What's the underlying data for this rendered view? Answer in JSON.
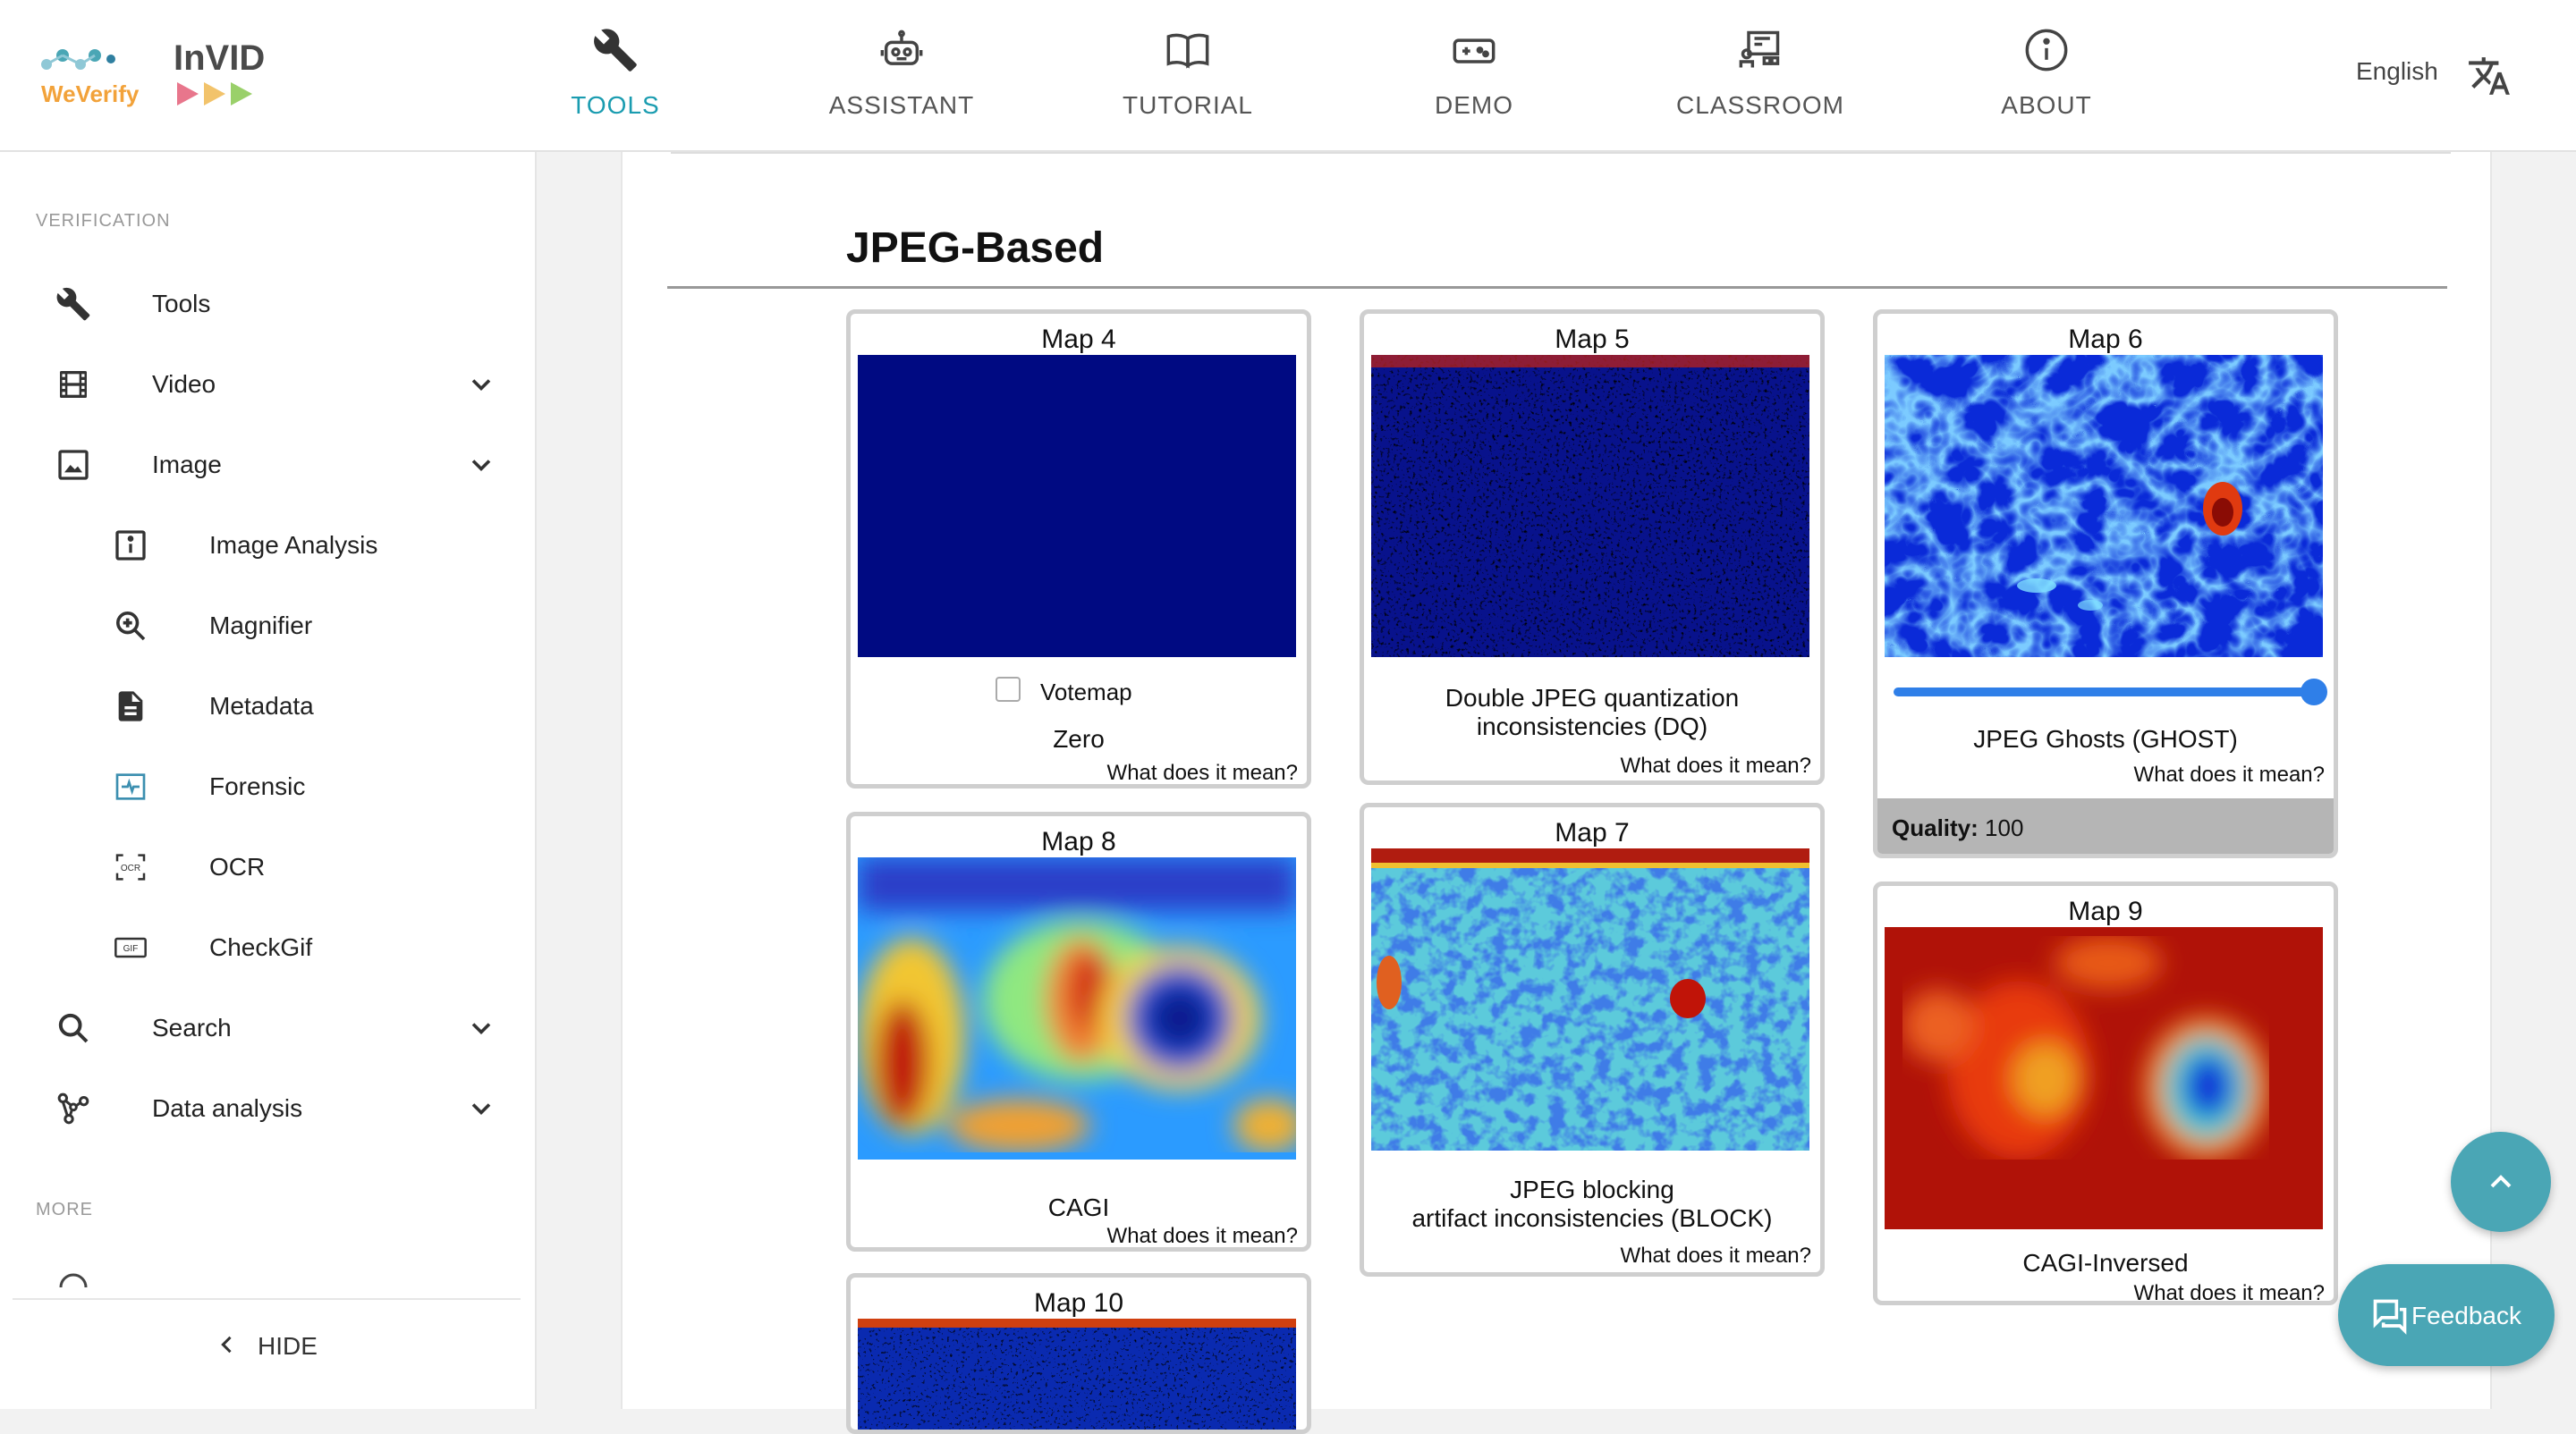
{
  "header": {
    "logo": {
      "brand_left": "WeVerify",
      "brand_right": "InVID"
    },
    "nav": [
      {
        "id": "tools",
        "label": "TOOLS",
        "icon": "wrench-icon",
        "active": true
      },
      {
        "id": "assistant",
        "label": "ASSISTANT",
        "icon": "robot-icon"
      },
      {
        "id": "tutorial",
        "label": "TUTORIAL",
        "icon": "book-icon"
      },
      {
        "id": "demo",
        "label": "DEMO",
        "icon": "gamepad-icon"
      },
      {
        "id": "classroom",
        "label": "CLASSROOM",
        "icon": "classroom-icon"
      },
      {
        "id": "about",
        "label": "ABOUT",
        "icon": "info-icon"
      }
    ],
    "language": "English",
    "language_icon": "translate-icon"
  },
  "sidebar": {
    "section_verification": "VERIFICATION",
    "items": [
      {
        "label": "Tools",
        "icon": "wrench-icon"
      },
      {
        "label": "Video",
        "icon": "film-icon",
        "expandable": true
      },
      {
        "label": "Image",
        "icon": "image-icon",
        "expandable": true
      },
      {
        "label": "Image Analysis",
        "icon": "info-square-icon"
      },
      {
        "label": "Magnifier",
        "icon": "magnifier-icon"
      },
      {
        "label": "Metadata",
        "icon": "document-icon"
      },
      {
        "label": "Forensic",
        "icon": "forensic-icon"
      },
      {
        "label": "OCR",
        "icon": "ocr-icon"
      },
      {
        "label": "CheckGif",
        "icon": "gif-icon"
      },
      {
        "label": "Search",
        "icon": "search-icon",
        "expandable": true
      },
      {
        "label": "Data analysis",
        "icon": "graph-icon",
        "expandable": true
      }
    ],
    "section_more": "MORE",
    "hide_label": "HIDE"
  },
  "main": {
    "section_title": "JPEG-Based",
    "maps": {
      "map4": {
        "title": "Map 4",
        "name": "Zero",
        "link": "What does it mean?",
        "votemap_label": "Votemap",
        "votemap_checked": false
      },
      "map5": {
        "title": "Map 5",
        "name_line1": "Double JPEG quantization",
        "name_line2": "inconsistencies (DQ)",
        "link": "What does it mean?"
      },
      "map6": {
        "title": "Map 6",
        "name": "JPEG Ghosts (GHOST)",
        "link": "What does it mean?",
        "quality_label": "Quality:",
        "quality_value": "100",
        "slider_fraction": 1.0
      },
      "map8": {
        "title": "Map 8",
        "name": "CAGI",
        "link": "What does it mean?"
      },
      "map7": {
        "title": "Map 7",
        "name_line1": "JPEG blocking",
        "name_line2": "artifact inconsistencies (BLOCK)",
        "link": "What does it mean?"
      },
      "map9": {
        "title": "Map 9",
        "name": "CAGI-Inversed",
        "link": "What does it mean?"
      },
      "map10": {
        "title": "Map 10"
      }
    }
  },
  "floating": {
    "scroll_top_icon": "chevron-up-icon",
    "feedback_label": "Feedback",
    "feedback_icon": "chat-icon"
  },
  "colors": {
    "accent": "#1a9cb0",
    "fab": "#4aa6b5",
    "slider": "#2f7fe8",
    "map_zero": "#000a82"
  }
}
